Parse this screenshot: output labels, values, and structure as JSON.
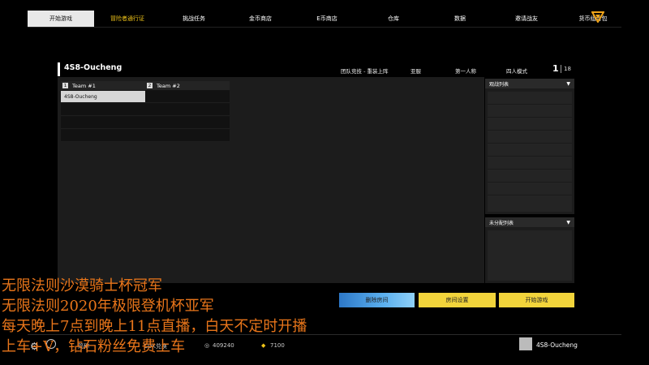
{
  "nav": {
    "tabs": [
      "开始游戏",
      "冒险者通行证",
      "挑战任务",
      "金币商店",
      "E币商店",
      "仓库",
      "数据",
      "邀请战友",
      "货币组合包"
    ],
    "active_index": 0,
    "logo_icon": "triangle-logo-icon"
  },
  "room": {
    "name": "4S8-Oucheng",
    "mode_label": "团队竞技 - 重装上阵",
    "map_label": "亚服",
    "view_label": "第一人称",
    "squad_label": "四人模式",
    "player_count": "1",
    "max_players": "18"
  },
  "teams": [
    {
      "num": "1",
      "label": "Team #1",
      "slots": [
        "4S8-Oucheng",
        "",
        "",
        "",
        ""
      ]
    },
    {
      "num": "2",
      "label": "Team #2",
      "slots": [
        "",
        "",
        "",
        "",
        ""
      ]
    }
  ],
  "side": {
    "spectators_label": "观战列表",
    "unassigned_label": "未分配列表"
  },
  "actions": {
    "delete_room": "删除房间",
    "room_settings": "房间设置",
    "start_game": "开始游戏"
  },
  "bottom": {
    "lang_label": "简称",
    "cdk_label": "CDK兑换",
    "coins": "409240",
    "ecoins": "7100",
    "profile_name": "4S8-Oucheng"
  },
  "captions": [
    "无限法则沙漠骑士杯冠军",
    "无限法则2020年极限登机杯亚军",
    "每天晚上7点到晚上11点直播，白天不定时开播",
    "上车+V，钻石粉丝免费上车"
  ],
  "colors": {
    "accent_gold": "#f0c419",
    "button_yellow": "#f2d43b",
    "button_blue": "#5cb0ee",
    "caption_orange": "#e8751a"
  }
}
